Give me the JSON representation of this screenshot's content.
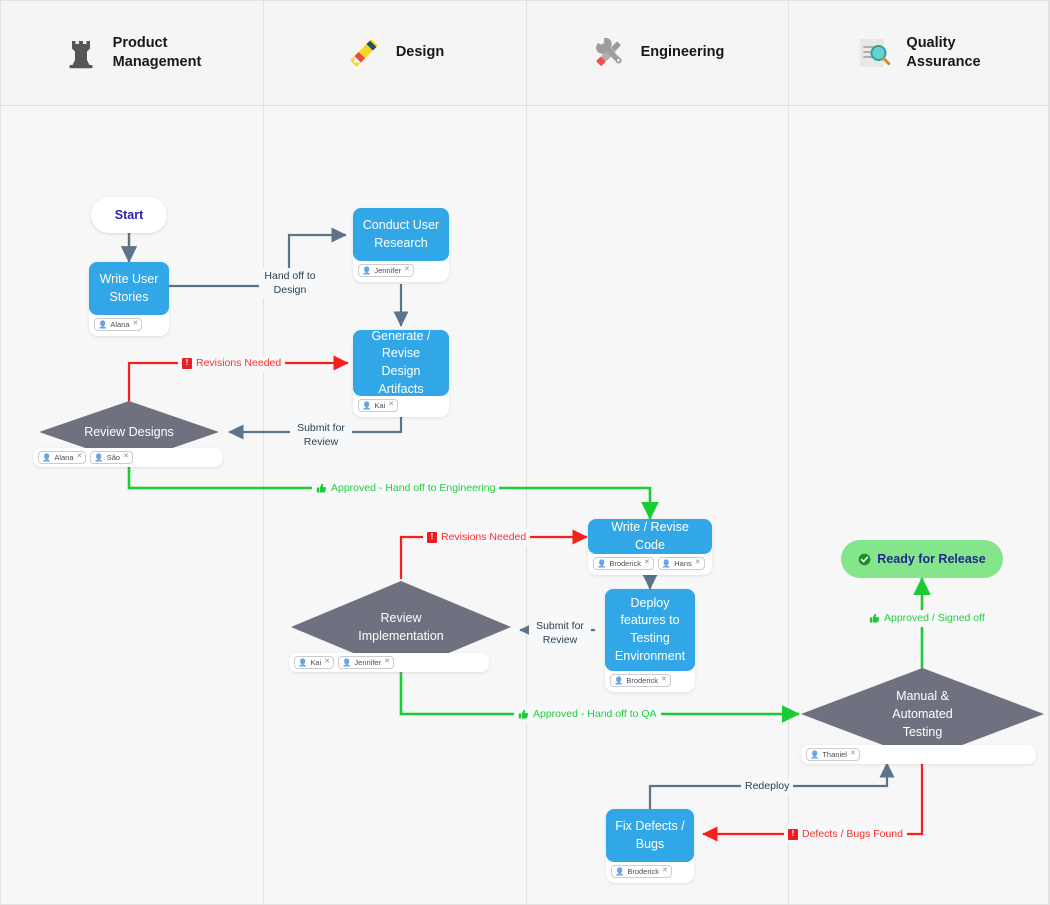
{
  "lanes": [
    {
      "id": "product-management",
      "label": "Product\nManagement",
      "label_line1": "Product",
      "label_line2": "Management",
      "icon": "rook-chess-piece-icon"
    },
    {
      "id": "design",
      "label": "Design",
      "label_line1": "Design",
      "label_line2": "",
      "icon": "ruler-pencil-icon"
    },
    {
      "id": "engineering",
      "label": "Engineering",
      "label_line1": "Engineering",
      "label_line2": "",
      "icon": "wrench-screwdriver-icon"
    },
    {
      "id": "quality-assurance",
      "label": "Quality\nAssurance",
      "label_line1": "Quality",
      "label_line2": "Assurance",
      "icon": "magnifier-document-icon"
    }
  ],
  "nodes": {
    "start": {
      "label": "Start",
      "type": "terminal"
    },
    "write_user_stories": {
      "label_line1": "Write User",
      "label_line2": "Stories",
      "assignees": [
        "Alana"
      ]
    },
    "conduct_user_research": {
      "label_line1": "Conduct User",
      "label_line2": "Research",
      "assignees": [
        "Jennifer"
      ]
    },
    "generate_design_artifacts": {
      "label_line1": "Generate /",
      "label_line2": "Revise Design",
      "label_line3": "Artifacts",
      "assignees": [
        "Kai"
      ]
    },
    "review_designs": {
      "label": "Review Designs",
      "assignees": [
        "Alana",
        "Sâo"
      ]
    },
    "write_revise_code": {
      "label": "Write / Revise Code",
      "assignees": [
        "Broderick",
        "Hans"
      ]
    },
    "deploy_features": {
      "label_line1": "Deploy",
      "label_line2": "features to",
      "label_line3": "Testing",
      "label_line4": "Environment",
      "assignees": [
        "Broderick"
      ]
    },
    "review_implementation": {
      "label_line1": "Review",
      "label_line2": "Implementation",
      "assignees": [
        "Kai",
        "Jennifer"
      ]
    },
    "manual_automated_testing": {
      "label_line1": "Manual &",
      "label_line2": "Automated",
      "label_line3": "Testing",
      "assignees": [
        "Thaniel"
      ]
    },
    "ready_for_release": {
      "label": "Ready for Release",
      "type": "terminal"
    },
    "fix_defects": {
      "label_line1": "Fix Defects /",
      "label_line2": "Bugs",
      "assignees": [
        "Broderick"
      ]
    }
  },
  "edges": {
    "hand_off_to_design": {
      "label_line1": "Hand off to",
      "label_line2": "Design",
      "style": "neutral"
    },
    "revisions_needed_design": {
      "label": "Revisions Needed",
      "style": "red",
      "icon": "exclamation-badge-icon"
    },
    "submit_for_review_design": {
      "label_line1": "Submit for",
      "label_line2": "Review",
      "style": "neutral"
    },
    "approved_hand_off_engineering": {
      "label": "Approved - Hand off to Engineering",
      "style": "green",
      "icon": "thumbs-up-icon"
    },
    "revisions_needed_code": {
      "label": "Revisions Needed",
      "style": "red",
      "icon": "exclamation-badge-icon"
    },
    "submit_for_review_impl": {
      "label_line1": "Submit for",
      "label_line2": "Review",
      "style": "neutral"
    },
    "approved_hand_off_qa": {
      "label": "Approved - Hand off to QA",
      "style": "green",
      "icon": "thumbs-up-icon"
    },
    "approved_signed_off": {
      "label": "Approved / Signed off",
      "style": "green",
      "icon": "thumbs-up-icon"
    },
    "defects_bugs_found": {
      "label": "Defects / Bugs Found",
      "style": "red",
      "icon": "exclamation-badge-icon"
    },
    "redeploy": {
      "label": "Redeploy",
      "style": "neutral"
    }
  },
  "chip_remove_glyph": "✕",
  "colors": {
    "task_blue": "#32a7e8",
    "decision_gray": "#6f7180",
    "approve_green": "#19cc35",
    "reject_red": "#f81e1e",
    "neutral_edge": "#5d7389",
    "release_green": "#84e58a",
    "start_text": "#2b1fa8",
    "canvas": "#f7f7f7",
    "lane_header": "#f5f5f5"
  }
}
